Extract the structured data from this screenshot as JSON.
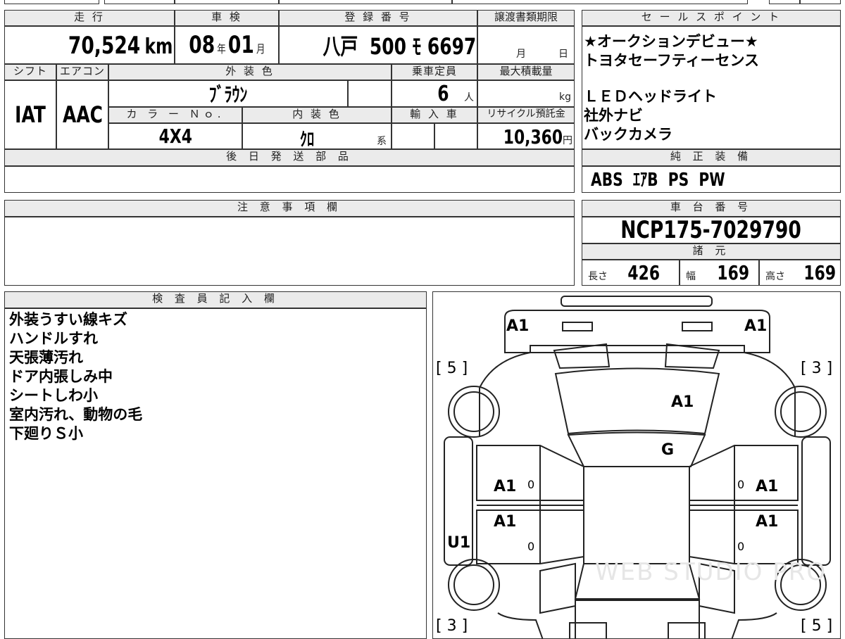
{
  "mileage": {
    "label": "走 行",
    "value": "70,524",
    "unit": "km"
  },
  "inspection": {
    "label": "車 検",
    "year": "08",
    "year_unit": "年",
    "month": "01",
    "month_unit": "月"
  },
  "registration": {
    "label": "登 録 番 号",
    "region": "八戸",
    "number": "500 ﾓ 6697"
  },
  "transfer": {
    "label": "譲渡書類期限",
    "month_unit": "月",
    "day_unit": "日"
  },
  "sales_points": {
    "label": "セ ー ル ス ポ イ ン ト",
    "lines": [
      "★オークションデビュー★",
      "トヨタセーフティーセンス",
      "",
      "ＬＥＤヘッドライト",
      "社外ナビ",
      "バックカメラ"
    ]
  },
  "shift": {
    "label": "シフト",
    "value": "IAT"
  },
  "aircon": {
    "label": "エアコン",
    "value": "AAC"
  },
  "exterior": {
    "label": "外 装 色",
    "value": "ﾌﾞﾗｳﾝ"
  },
  "capacity": {
    "label": "乗車定員",
    "value": "6",
    "unit": "人"
  },
  "max_load": {
    "label": "最大積載量",
    "unit": "kg"
  },
  "color_no": {
    "label": "カ ラ ー Ｎｏ.",
    "value": "4X4"
  },
  "interior": {
    "label": "内 装 色",
    "value": "ｸﾛ",
    "unit": "系"
  },
  "import": {
    "label": "輸 入 車"
  },
  "recycle": {
    "label": "リサイクル預託金",
    "value": "10,360",
    "unit": "円"
  },
  "later_parts": {
    "label": "後 日 発 送 部 品"
  },
  "equipment": {
    "label": "純 正 装 備",
    "value": "ABS  ｴｱB  PS  PW"
  },
  "notes": {
    "label": "注 意 事 項 欄"
  },
  "chassis": {
    "label": "車 台 番 号",
    "value": "NCP175-7029790"
  },
  "specs": {
    "label": "諸 元",
    "length_label": "長さ",
    "length": "426",
    "width_label": "幅",
    "width": "169",
    "height_label": "高さ",
    "height": "169"
  },
  "inspector": {
    "label": "検 査 員 記 入 欄",
    "lines": [
      "外装うすい線キズ",
      "ハンドルすれ",
      "天張薄汚れ",
      "ドア内張しみ中",
      "シートしわ小",
      "室内汚れ、動物の毛",
      "下廻りＳ小"
    ]
  },
  "diagram": {
    "fl_corner": "A1",
    "fr_corner": "A1",
    "hood": "A1",
    "windshield": "G",
    "door_fl": "A1",
    "door_fr": "A1",
    "door_rl": "A1",
    "door_rr": "A1",
    "side_left": "U1",
    "zero": "0",
    "tire_fl": "[ 5 ]",
    "tire_fr": "[ 3 ]",
    "tire_rl": "[ 3 ]",
    "tire_rr": "[ 5 ]",
    "watermark": "WEB STUDIO PRO"
  }
}
